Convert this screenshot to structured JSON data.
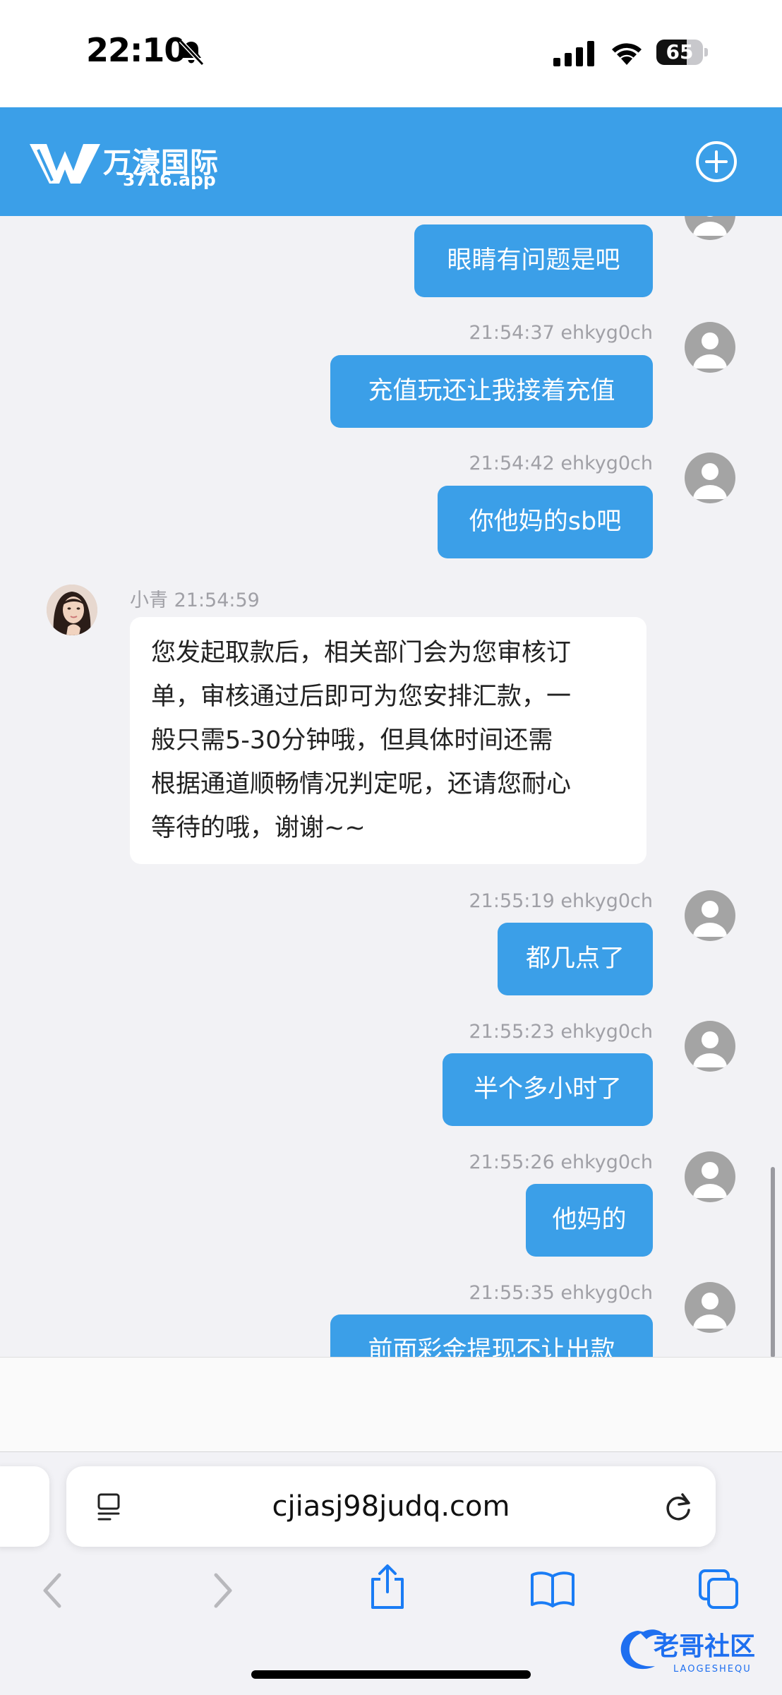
{
  "status_bar": {
    "time": "22:10",
    "battery": "65"
  },
  "header": {
    "brand": "万濠国际",
    "domain": "3716.app"
  },
  "messages": [
    {
      "side": "out",
      "text": "眼睛有问题是吧",
      "meta": ""
    },
    {
      "side": "out",
      "text": "充值玩还让我接着充值",
      "meta": "21:54:37 ehkyg0ch"
    },
    {
      "side": "out",
      "text": "你他妈的sb吧",
      "meta": "21:54:42 ehkyg0ch"
    },
    {
      "side": "in",
      "text": "您发起取款后，相关部门会为您审核订\n单，审核通过后即可为您安排汇款，一\n般只需5-30分钟哦，但具体时间还需\n根据通道顺畅情况判定呢，还请您耐心\n等待的哦，谢谢~~",
      "meta": "小青 21:54:59"
    },
    {
      "side": "out",
      "text": "都几点了",
      "meta": "21:55:19 ehkyg0ch"
    },
    {
      "side": "out",
      "text": "半个多小时了",
      "meta": "21:55:23 ehkyg0ch"
    },
    {
      "side": "out",
      "text": "他妈的",
      "meta": "21:55:26 ehkyg0ch"
    },
    {
      "side": "out",
      "text": "前面彩金提现不让出款",
      "meta": "21:55:35 ehkyg0ch"
    }
  ],
  "browser": {
    "url": "cjiasj98judq.com"
  },
  "watermark": {
    "text": "老哥社区",
    "sub": "LAOGESHEQU"
  },
  "colors": {
    "accent": "#3b9fe8",
    "ios_blue": "#1a7cf5"
  }
}
